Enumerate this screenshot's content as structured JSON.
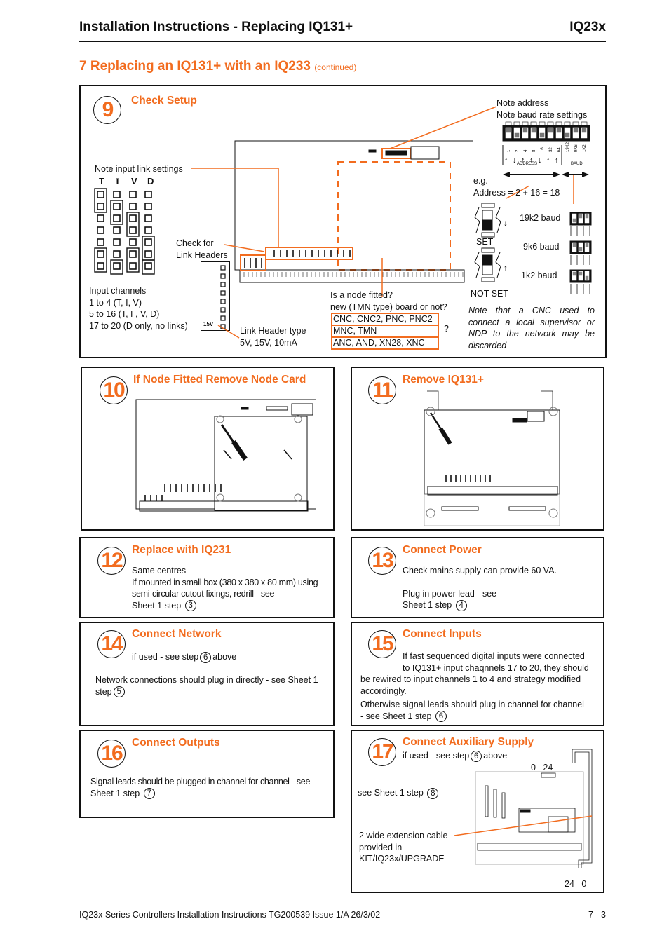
{
  "header": {
    "title": "Installation Instructions - Replacing IQ131+",
    "product": "IQ23x"
  },
  "section": {
    "title": "7 Replacing an IQ131+ with an IQ233",
    "suffix": "(continued)"
  },
  "colors": {
    "accent": "#f26c1f",
    "text": "#111111"
  },
  "step9": {
    "number": "9",
    "title": "Check Setup",
    "note_input_links": "Note input link settings",
    "link_columns": [
      "T",
      "I",
      "V",
      "D"
    ],
    "input_channels": [
      "Input channels",
      "1 to 4 (T, I, V)",
      "5 to 16 (T, I , V, D)",
      "17 to 20 (D only, no links)"
    ],
    "check_link_headers": [
      "Check for",
      "Link Headers"
    ],
    "header_label": "15V",
    "link_header_type": [
      "Link Header type",
      "5V, 15V, 10mA"
    ],
    "node_question": [
      "Is a node fitted?",
      "new (TMN type) board or not?"
    ],
    "node_options": [
      "CNC, CNC2, PNC, PNC2",
      "MNC, TMN",
      "ANC, AND, XN28, XNC"
    ],
    "node_question_mark": "?",
    "note_address": [
      "Note address",
      "Note baud rate settings"
    ],
    "dip_labels": [
      "1",
      "2",
      "4",
      "8",
      "16",
      "32",
      "64",
      "19K2",
      "9K6",
      "1K2"
    ],
    "dip_arrows": [
      "↑",
      "↓",
      "↑",
      "↑",
      "↓",
      "↑",
      "↑"
    ],
    "address_label": "ADDRESS",
    "baud_label": "BAUD",
    "example": [
      "e.g.",
      "Address = 2 + 16 = 18"
    ],
    "set_label": "SET",
    "not_set_label": "NOT SET",
    "baud_rates": [
      "19k2 baud",
      "9k6 baud",
      "1k2 baud"
    ],
    "cnc_note": "Note that a CNC used to connect a local supervisor or NDP to the network may be discarded"
  },
  "step10": {
    "number": "10",
    "title": "If Node Fitted Remove Node Card"
  },
  "step11": {
    "number": "11",
    "title": "Remove IQ131+"
  },
  "step12": {
    "number": "12",
    "title": "Replace with IQ231",
    "line1": "Same centres",
    "line2": "If mounted in small box (380 x 380 x 80 mm) using semi-circular cutout fixings, redrill - see",
    "line3": "Sheet 1 step",
    "ref": "3"
  },
  "step13": {
    "number": "13",
    "title": "Connect Power",
    "line1": "Check mains supply can provide 60 VA.",
    "line2": "Plug in power lead - see",
    "line3": "Sheet 1 step",
    "ref": "4"
  },
  "step14": {
    "number": "14",
    "title": "Connect Network",
    "line1a": "if used - see step",
    "ref1": "6",
    "line1b": "above",
    "line2": "Network connections should plug in directly - see Sheet 1",
    "line3": "step",
    "ref2": "5"
  },
  "step15": {
    "number": "15",
    "title": "Connect Inputs",
    "line1": "If fast sequenced digital inputs were connected",
    "line2": "to IQ131+ input chaqnnels 17 to 20, they should",
    "line3": "be rewired to input channels 1 to 4 and strategy modified accordingly.",
    "line4": "Otherwise signal leads should plug in channel for channel",
    "line5": "- see Sheet 1 step",
    "ref": "6"
  },
  "step16": {
    "number": "16",
    "title": "Connect Outputs",
    "line1": "Signal leads should be plugged in channel for channel - see",
    "line2": "Sheet 1 step",
    "ref": "7"
  },
  "step17": {
    "number": "17",
    "title": "Connect Auxiliary Supply",
    "line1a": "if used - see step",
    "ref1": "6",
    "line1b": "above",
    "line2": "see Sheet 1 step",
    "ref2": "8",
    "cable_note": [
      "2 wide extension cable",
      "provided in",
      "KIT/IQ23x/UPGRADE"
    ],
    "top_terminal": [
      "0",
      "24"
    ],
    "bottom_terminal": [
      "24",
      "0"
    ]
  },
  "footer": {
    "doc": "IQ23x Series Controllers Installation Instructions TG200539 Issue 1/A 26/3/02",
    "page": "7 - 3"
  }
}
